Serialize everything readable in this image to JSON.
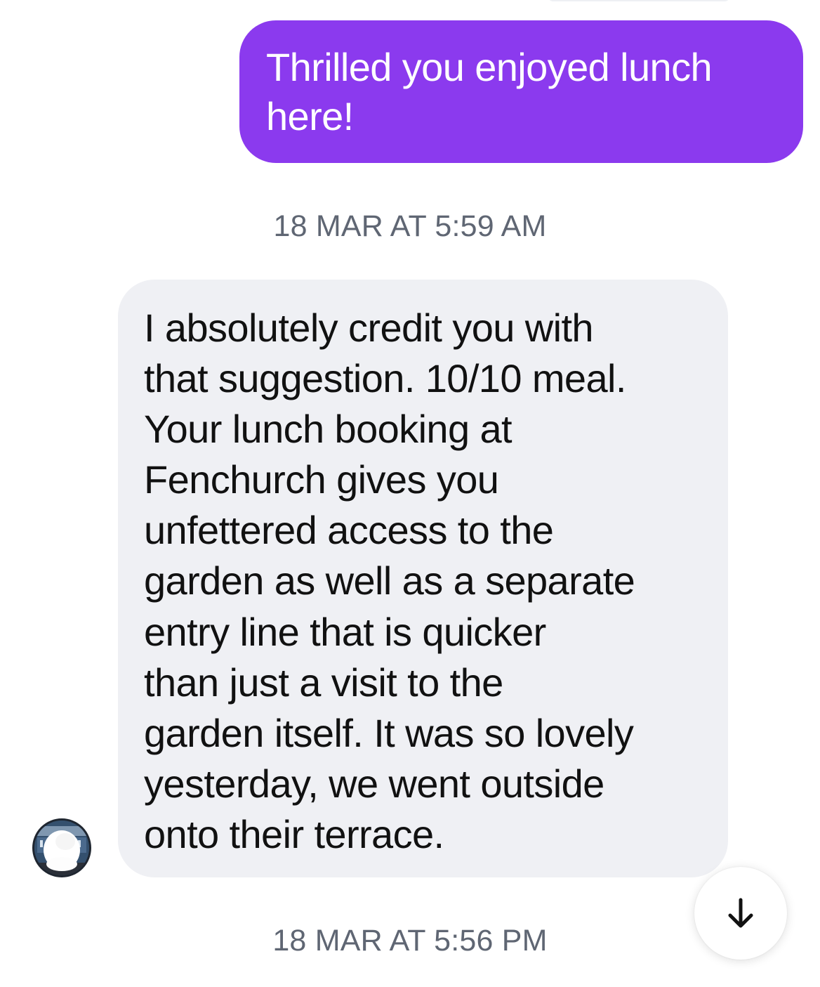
{
  "conversation": {
    "messages": [
      {
        "direction": "outgoing",
        "text": "Thrilled you enjoyed lunch here!"
      },
      {
        "direction": "incoming",
        "text": "I absolutely credit you with\nthat suggestion. 10/10 meal.\nYour lunch booking at\nFenchurch gives you\nunfettered access to the\ngarden as well as a separate\nentry line that is quicker\nthan just a visit to the\ngarden itself. It was so lovely\nyesterday, we went outside\nonto their terrace."
      }
    ],
    "timestamps": [
      "18 MAR AT 5:59 AM",
      "18 MAR AT 5:56 PM"
    ]
  },
  "colors": {
    "outgoing_bubble": "#8b3aee",
    "incoming_bubble": "#eff0f4",
    "timestamp_text": "#5f6673"
  },
  "icons": {
    "scroll_down": "arrow-down-icon",
    "avatar": "contact-avatar"
  }
}
